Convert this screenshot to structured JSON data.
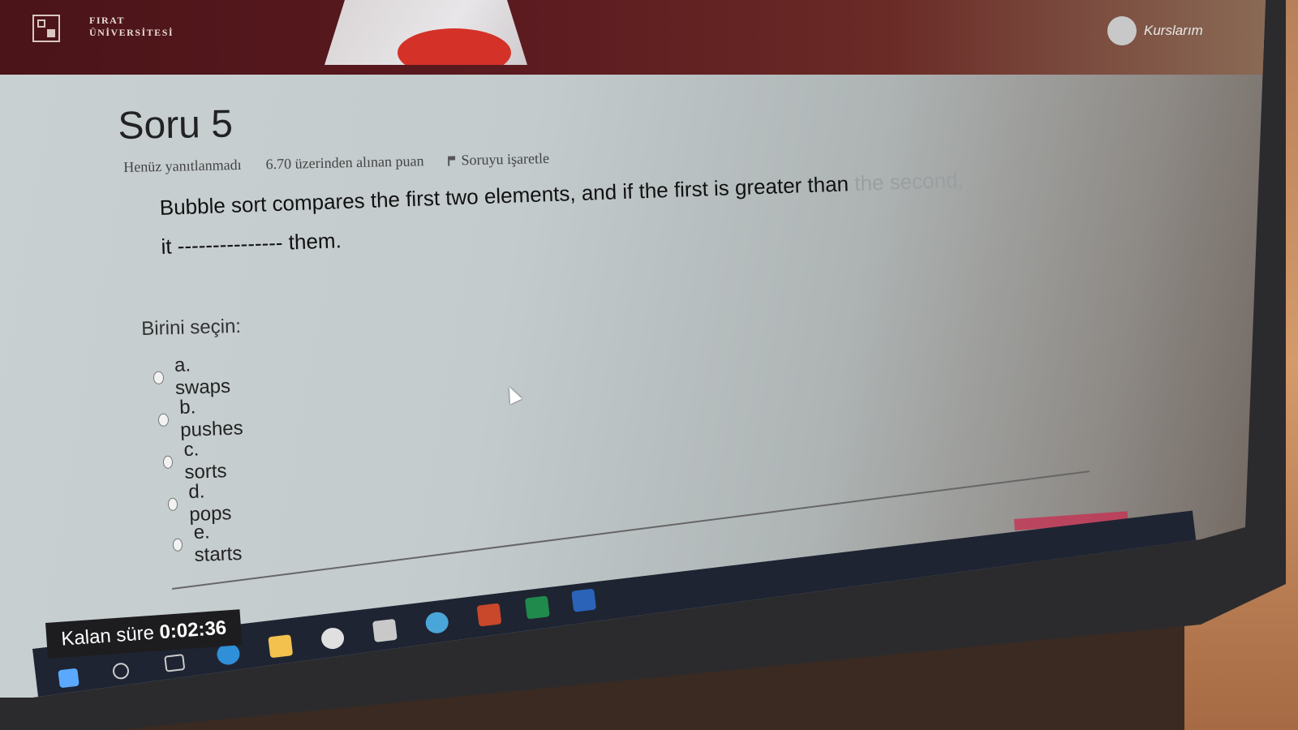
{
  "header": {
    "university_name": "FIRAT\nÜNİVERSİTESİ",
    "my_courses_label": "Kurslarım"
  },
  "question": {
    "title": "Soru 5",
    "status": "Henüz yanıtlanmadı",
    "points": "6.70 üzerinden alınan puan",
    "flag_label": "Soruyu işaretle",
    "text_main": "Bubble sort compares the first two elements, and if the first is greater than ",
    "text_faded": "the second,",
    "text_line2": "it --------------- them.",
    "choose_label": "Birini seçin:",
    "options": [
      {
        "label": "a. swaps"
      },
      {
        "label": "b. pushes"
      },
      {
        "label": "c. sorts"
      },
      {
        "label": "d. pops"
      },
      {
        "label": "e. starts"
      }
    ]
  },
  "timer": {
    "label": "Kalan süre",
    "value": "0:02:36"
  },
  "taskbar": {
    "icons": [
      "windows-start-icon",
      "search-icon",
      "task-view-icon",
      "edge-icon",
      "file-explorer-icon",
      "chrome-icon",
      "store-icon",
      "media-icon",
      "powerpoint-icon",
      "excel-icon",
      "word-icon"
    ],
    "colors": {
      "windows": "#5aa9ff",
      "edge": "#2f8fd8",
      "explorer": "#f2c14e",
      "chrome": "#e0e0e0",
      "store": "#c9c9c9",
      "media": "#4aa6d8",
      "powerpoint": "#c9472b",
      "excel": "#1f8a4c",
      "word": "#2a63b8"
    }
  }
}
